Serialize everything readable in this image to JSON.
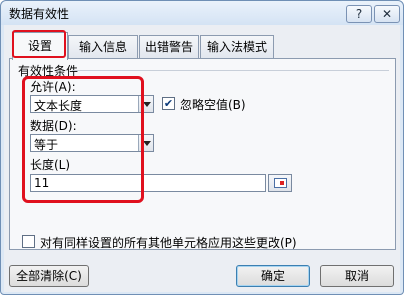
{
  "window": {
    "title": "数据有效性",
    "help_label": "?",
    "close_label": "✕"
  },
  "tabs": [
    {
      "label": "设置"
    },
    {
      "label": "输入信息"
    },
    {
      "label": "出错警告"
    },
    {
      "label": "输入法模式"
    }
  ],
  "validation": {
    "section_title": "有效性条件",
    "allow_label": "允许(A):",
    "allow_value": "文本长度",
    "ignore_blank_label": "忽略空值(B)",
    "ignore_blank_checked": "✔",
    "data_label": "数据(D):",
    "data_value": "等于",
    "length_label": "长度(L)",
    "length_value": "11"
  },
  "apply_all": {
    "label": "对有同样设置的所有其他单元格应用这些更改(P)"
  },
  "buttons": {
    "clear_all": "全部清除(C)",
    "ok": "确定",
    "cancel": "取消"
  },
  "colors": {
    "highlight": "#e0101e",
    "window_bg": "#dce8f5"
  },
  "icons": [
    "help-icon",
    "close-icon",
    "chevron-down-icon",
    "check-icon",
    "range-select-icon"
  ]
}
